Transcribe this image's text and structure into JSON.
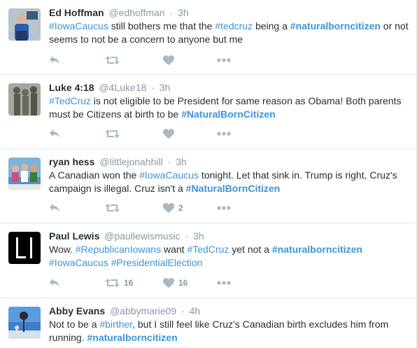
{
  "colors": {
    "link": "#3b94d9",
    "muted": "#8899a6",
    "icon": "#aab8c2"
  },
  "tweets": [
    {
      "name": "Ed Hoffman",
      "handle": "@edhoffman",
      "sep": "·",
      "time": "3h",
      "avatar": "person-photo",
      "text": [
        {
          "t": "#IowaCaucus",
          "k": "tag"
        },
        {
          "t": " still bothers me that the ",
          "k": "plain"
        },
        {
          "t": "#tedcruz",
          "k": "tag"
        },
        {
          "t": " being a ",
          "k": "plain"
        },
        {
          "t": "#naturalborncitizen",
          "k": "tagb"
        },
        {
          "t": " or not seems to not be a concern to anyone but me",
          "k": "plain"
        }
      ],
      "retweets": "",
      "likes": ""
    },
    {
      "name": "Luke 4:18",
      "handle": "@4Luke18",
      "sep": "·",
      "time": "3h",
      "avatar": "statue-photo",
      "text": [
        {
          "t": "#TedCruz",
          "k": "tag"
        },
        {
          "t": " is not eligible to be President for same reason as Obama! Both parents must be Citizens at birth to be ",
          "k": "plain"
        },
        {
          "t": "#NaturalBornCitizen",
          "k": "tagb"
        }
      ],
      "retweets": "",
      "likes": ""
    },
    {
      "name": "ryan hess",
      "handle": "@littlejonahhill",
      "sep": "·",
      "time": "3h",
      "avatar": "group-photo",
      "text": [
        {
          "t": "A Canadian won the ",
          "k": "plain"
        },
        {
          "t": "#IowaCaucus",
          "k": "tag"
        },
        {
          "t": " tonight. Let that sink in. Trump is right, Cruz's campaign is illegal. Cruz isn't a ",
          "k": "plain"
        },
        {
          "t": "#NaturalBornCitizen",
          "k": "tagb"
        }
      ],
      "retweets": "",
      "likes": "2"
    },
    {
      "name": "Paul Lewis",
      "handle": "@paullewismusic",
      "sep": "·",
      "time": "3h",
      "avatar": "logo-mark",
      "text": [
        {
          "t": "Wow. ",
          "k": "plain"
        },
        {
          "t": "#RepublicanIowans",
          "k": "tag"
        },
        {
          "t": " want ",
          "k": "plain"
        },
        {
          "t": "#TedCruz",
          "k": "tag"
        },
        {
          "t": " yet not a ",
          "k": "plain"
        },
        {
          "t": "#naturalborncitizen",
          "k": "tagb"
        },
        {
          "t": " ",
          "k": "plain"
        },
        {
          "t": "#IowaCaucus",
          "k": "tag"
        },
        {
          "t": " ",
          "k": "plain"
        },
        {
          "t": "#PresidentialElection",
          "k": "tag"
        }
      ],
      "retweets": "16",
      "likes": "16"
    },
    {
      "name": "Abby Evans",
      "handle": "@abbymarie09",
      "sep": "·",
      "time": "4h",
      "avatar": "landscape-photo",
      "text": [
        {
          "t": "Not to be a ",
          "k": "plain"
        },
        {
          "t": "#birther",
          "k": "tag"
        },
        {
          "t": ", but I still feel like Cruz's Canadian birth excludes him from running. ",
          "k": "plain"
        },
        {
          "t": "#naturalborncitizen",
          "k": "tagb"
        }
      ],
      "retweets": "",
      "likes": ""
    }
  ],
  "icons": {
    "reply": "reply-icon",
    "retweet": "retweet-icon",
    "like": "heart-icon",
    "more": "more-icon"
  }
}
